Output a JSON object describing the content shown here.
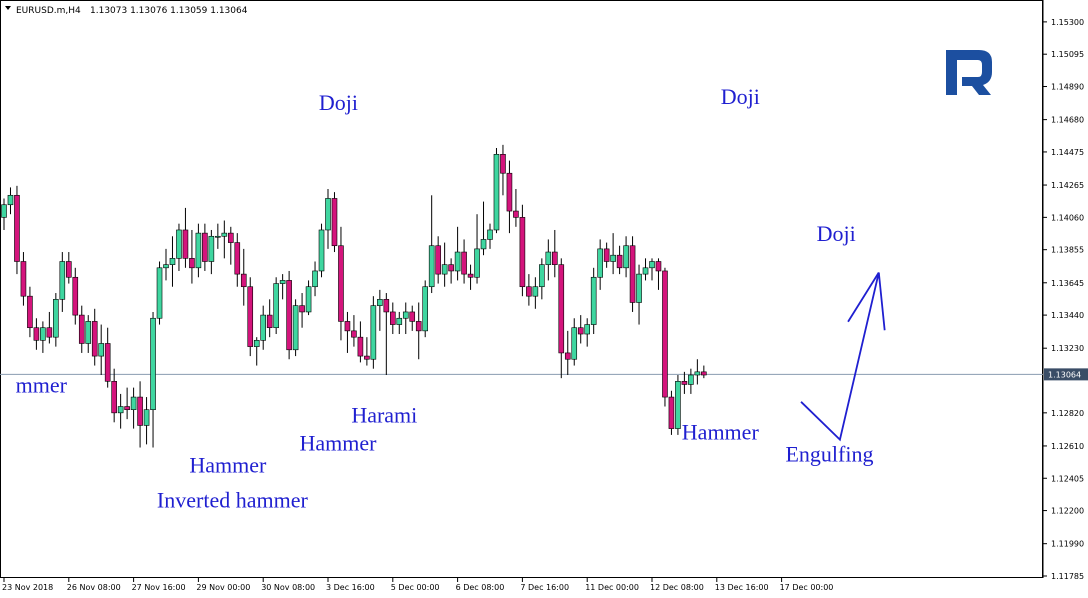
{
  "header": {
    "symbol": "EURUSD.m,H4",
    "ohlc": "1.13073 1.13076 1.13059 1.13064"
  },
  "current_price_label": "1.13064",
  "colors": {
    "bull": "#3fd6a0",
    "bear": "#d4147c",
    "wick": "#000000",
    "annotation": "#1f1fd0",
    "price_line": "#8a9bb0",
    "logo": "#1c4fa0"
  },
  "logo": {
    "text": "R",
    "icon": "roboforex-logo-icon"
  },
  "annotations": [
    {
      "text": "Doji",
      "time_index": 48.6,
      "price": 1.1474
    },
    {
      "text": "Doji",
      "time_index": 110.6,
      "price": 1.1478
    },
    {
      "text": "Doji",
      "time_index": 125.4,
      "price": 1.1391
    },
    {
      "text": "mmer",
      "time_index": 1.8,
      "price": 1.1295
    },
    {
      "text": "Harami",
      "time_index": 53.6,
      "price": 1.1276
    },
    {
      "text": "Hammer",
      "time_index": 45.6,
      "price": 1.1258
    },
    {
      "text": "Hammer",
      "time_index": 28.6,
      "price": 1.1244
    },
    {
      "text": "Inverted hammer",
      "time_index": 23.6,
      "price": 1.1222
    },
    {
      "text": "Hammer",
      "time_index": 104.6,
      "price": 1.1265
    },
    {
      "text": "Engulfing",
      "time_index": 120.6,
      "price": 1.1251
    }
  ],
  "chart_data": {
    "type": "candlestick",
    "symbol": "EURUSD.m",
    "timeframe": "H4",
    "ylim": [
      1.11785,
      1.1535
    ],
    "y_ticks": [
      1.153,
      1.15095,
      1.1489,
      1.1468,
      1.14475,
      1.14265,
      1.1406,
      1.13855,
      1.13645,
      1.1344,
      1.1323,
      1.1282,
      1.1261,
      1.12405,
      1.122,
      1.1199,
      1.11785
    ],
    "x_ticks": [
      {
        "label": "23 Nov 2018",
        "index": 0
      },
      {
        "label": "26 Nov 08:00",
        "index": 10
      },
      {
        "label": "27 Nov 16:00",
        "index": 20
      },
      {
        "label": "29 Nov 00:00",
        "index": 30
      },
      {
        "label": "30 Nov 08:00",
        "index": 40
      },
      {
        "label": "3 Dec 16:00",
        "index": 50
      },
      {
        "label": "5 Dec 00:00",
        "index": 60
      },
      {
        "label": "6 Dec 08:00",
        "index": 70
      },
      {
        "label": "7 Dec 16:00",
        "index": 80
      },
      {
        "label": "11 Dec 00:00",
        "index": 90
      },
      {
        "label": "12 Dec 08:00",
        "index": 100
      },
      {
        "label": "13 Dec 16:00",
        "index": 110
      },
      {
        "label": "17 Dec 00:00",
        "index": 120
      }
    ],
    "candles": [
      [
        1.1406,
        1.1418,
        1.1398,
        1.1414
      ],
      [
        1.1414,
        1.1425,
        1.1408,
        1.142
      ],
      [
        1.142,
        1.1426,
        1.137,
        1.1378
      ],
      [
        1.1378,
        1.1384,
        1.135,
        1.1356
      ],
      [
        1.1356,
        1.1362,
        1.133,
        1.1336
      ],
      [
        1.1336,
        1.1342,
        1.1322,
        1.1328
      ],
      [
        1.1328,
        1.134,
        1.132,
        1.1336
      ],
      [
        1.1336,
        1.1346,
        1.1326,
        1.133
      ],
      [
        1.133,
        1.1358,
        1.1324,
        1.1354
      ],
      [
        1.1354,
        1.1384,
        1.1346,
        1.1378
      ],
      [
        1.1378,
        1.1384,
        1.1364,
        1.1368
      ],
      [
        1.1368,
        1.1374,
        1.1338,
        1.1344
      ],
      [
        1.1344,
        1.135,
        1.132,
        1.1326
      ],
      [
        1.1326,
        1.1344,
        1.132,
        1.134
      ],
      [
        1.134,
        1.1348,
        1.1312,
        1.1318
      ],
      [
        1.1318,
        1.1338,
        1.1306,
        1.1326
      ],
      [
        1.1326,
        1.1336,
        1.1298,
        1.1302
      ],
      [
        1.1302,
        1.131,
        1.1276,
        1.1282
      ],
      [
        1.1282,
        1.1294,
        1.1272,
        1.1286
      ],
      [
        1.1286,
        1.1298,
        1.1278,
        1.1284
      ],
      [
        1.1284,
        1.1298,
        1.1272,
        1.1292
      ],
      [
        1.1292,
        1.1302,
        1.126,
        1.1274
      ],
      [
        1.1274,
        1.1292,
        1.1262,
        1.1284
      ],
      [
        1.1284,
        1.1346,
        1.126,
        1.1342
      ],
      [
        1.1342,
        1.1378,
        1.1338,
        1.1374
      ],
      [
        1.1374,
        1.1386,
        1.1366,
        1.1376
      ],
      [
        1.1376,
        1.1394,
        1.1362,
        1.138
      ],
      [
        1.138,
        1.1402,
        1.1372,
        1.1398
      ],
      [
        1.1398,
        1.1412,
        1.1374,
        1.138
      ],
      [
        1.138,
        1.1398,
        1.1364,
        1.1374
      ],
      [
        1.1374,
        1.1402,
        1.1368,
        1.1396
      ],
      [
        1.1396,
        1.1402,
        1.1372,
        1.1378
      ],
      [
        1.1378,
        1.1398,
        1.137,
        1.1394
      ],
      [
        1.1394,
        1.1402,
        1.1386,
        1.1394
      ],
      [
        1.1394,
        1.1404,
        1.138,
        1.1396
      ],
      [
        1.1396,
        1.14,
        1.1376,
        1.139
      ],
      [
        1.139,
        1.1396,
        1.1362,
        1.137
      ],
      [
        1.137,
        1.1386,
        1.135,
        1.1362
      ],
      [
        1.1362,
        1.1368,
        1.1318,
        1.1324
      ],
      [
        1.1324,
        1.133,
        1.1312,
        1.1328
      ],
      [
        1.1328,
        1.135,
        1.1322,
        1.1344
      ],
      [
        1.1344,
        1.1354,
        1.133,
        1.1336
      ],
      [
        1.1336,
        1.1368,
        1.1332,
        1.1364
      ],
      [
        1.1364,
        1.137,
        1.1354,
        1.1366
      ],
      [
        1.1366,
        1.1372,
        1.1316,
        1.1322
      ],
      [
        1.1322,
        1.1354,
        1.1318,
        1.135
      ],
      [
        1.135,
        1.1358,
        1.1336,
        1.1346
      ],
      [
        1.1346,
        1.1366,
        1.1344,
        1.1362
      ],
      [
        1.1362,
        1.1378,
        1.1356,
        1.1372
      ],
      [
        1.1372,
        1.1402,
        1.1368,
        1.1398
      ],
      [
        1.1398,
        1.1424,
        1.1386,
        1.1418
      ],
      [
        1.1418,
        1.1422,
        1.1384,
        1.1388
      ],
      [
        1.1388,
        1.14,
        1.1328,
        1.134
      ],
      [
        1.134,
        1.1346,
        1.132,
        1.1334
      ],
      [
        1.1334,
        1.1344,
        1.1324,
        1.133
      ],
      [
        1.133,
        1.134,
        1.1314,
        1.1318
      ],
      [
        1.1318,
        1.133,
        1.1312,
        1.1316
      ],
      [
        1.1316,
        1.1356,
        1.131,
        1.135
      ],
      [
        1.135,
        1.136,
        1.1334,
        1.1354
      ],
      [
        1.1354,
        1.1358,
        1.1306,
        1.1346
      ],
      [
        1.1346,
        1.1352,
        1.1332,
        1.1338
      ],
      [
        1.1338,
        1.1346,
        1.1332,
        1.1342
      ],
      [
        1.1342,
        1.1352,
        1.1332,
        1.1346
      ],
      [
        1.1346,
        1.135,
        1.1334,
        1.134
      ],
      [
        1.134,
        1.1352,
        1.1316,
        1.1334
      ],
      [
        1.1334,
        1.1366,
        1.133,
        1.1362
      ],
      [
        1.1362,
        1.142,
        1.1358,
        1.1388
      ],
      [
        1.1388,
        1.1394,
        1.1364,
        1.137
      ],
      [
        1.137,
        1.139,
        1.1362,
        1.1376
      ],
      [
        1.1376,
        1.138,
        1.1364,
        1.1372
      ],
      [
        1.1372,
        1.14,
        1.1366,
        1.1384
      ],
      [
        1.1384,
        1.1392,
        1.1364,
        1.137
      ],
      [
        1.137,
        1.1376,
        1.136,
        1.1368
      ],
      [
        1.1368,
        1.1408,
        1.1364,
        1.1386
      ],
      [
        1.1386,
        1.1416,
        1.1382,
        1.1392
      ],
      [
        1.1392,
        1.1402,
        1.1386,
        1.1398
      ],
      [
        1.1398,
        1.145,
        1.1396,
        1.1446
      ],
      [
        1.1446,
        1.1452,
        1.142,
        1.1434
      ],
      [
        1.1434,
        1.1442,
        1.1396,
        1.141
      ],
      [
        1.141,
        1.1424,
        1.14,
        1.1406
      ],
      [
        1.1406,
        1.1414,
        1.1356,
        1.1362
      ],
      [
        1.1362,
        1.137,
        1.135,
        1.1356
      ],
      [
        1.1356,
        1.1368,
        1.1348,
        1.1362
      ],
      [
        1.1362,
        1.138,
        1.1354,
        1.1376
      ],
      [
        1.1376,
        1.1392,
        1.1366,
        1.1384
      ],
      [
        1.1384,
        1.1398,
        1.1368,
        1.1376
      ],
      [
        1.1376,
        1.138,
        1.1304,
        1.132
      ],
      [
        1.132,
        1.1334,
        1.1306,
        1.1316
      ],
      [
        1.1316,
        1.1342,
        1.1312,
        1.1336
      ],
      [
        1.1336,
        1.1344,
        1.1326,
        1.1332
      ],
      [
        1.1332,
        1.1342,
        1.1324,
        1.1338
      ],
      [
        1.1338,
        1.1374,
        1.1332,
        1.1368
      ],
      [
        1.1368,
        1.1392,
        1.136,
        1.1386
      ],
      [
        1.1386,
        1.139,
        1.1374,
        1.1378
      ],
      [
        1.1378,
        1.1396,
        1.137,
        1.1382
      ],
      [
        1.1382,
        1.1388,
        1.137,
        1.1374
      ],
      [
        1.1374,
        1.1394,
        1.1368,
        1.1388
      ],
      [
        1.1388,
        1.1394,
        1.1346,
        1.1352
      ],
      [
        1.1352,
        1.1376,
        1.1338,
        1.137
      ],
      [
        1.137,
        1.138,
        1.1366,
        1.1374
      ],
      [
        1.1374,
        1.138,
        1.1366,
        1.1378
      ],
      [
        1.1378,
        1.138,
        1.136,
        1.1372
      ],
      [
        1.1372,
        1.1374,
        1.1286,
        1.1292
      ],
      [
        1.1292,
        1.1296,
        1.1268,
        1.1272
      ],
      [
        1.1272,
        1.1306,
        1.1268,
        1.1302
      ],
      [
        1.1302,
        1.1308,
        1.1294,
        1.13
      ],
      [
        1.13,
        1.131,
        1.1294,
        1.1306
      ],
      [
        1.1306,
        1.1316,
        1.13,
        1.1308
      ],
      [
        1.1308,
        1.1312,
        1.1304,
        1.1306
      ]
    ],
    "current_price": 1.13064,
    "forecast_path": [
      {
        "time_index": 123.0,
        "price": 1.1289
      },
      {
        "time_index": 129.0,
        "price": 1.1265
      },
      {
        "time_index": 135.0,
        "price": 1.1371
      }
    ],
    "grid": false
  }
}
